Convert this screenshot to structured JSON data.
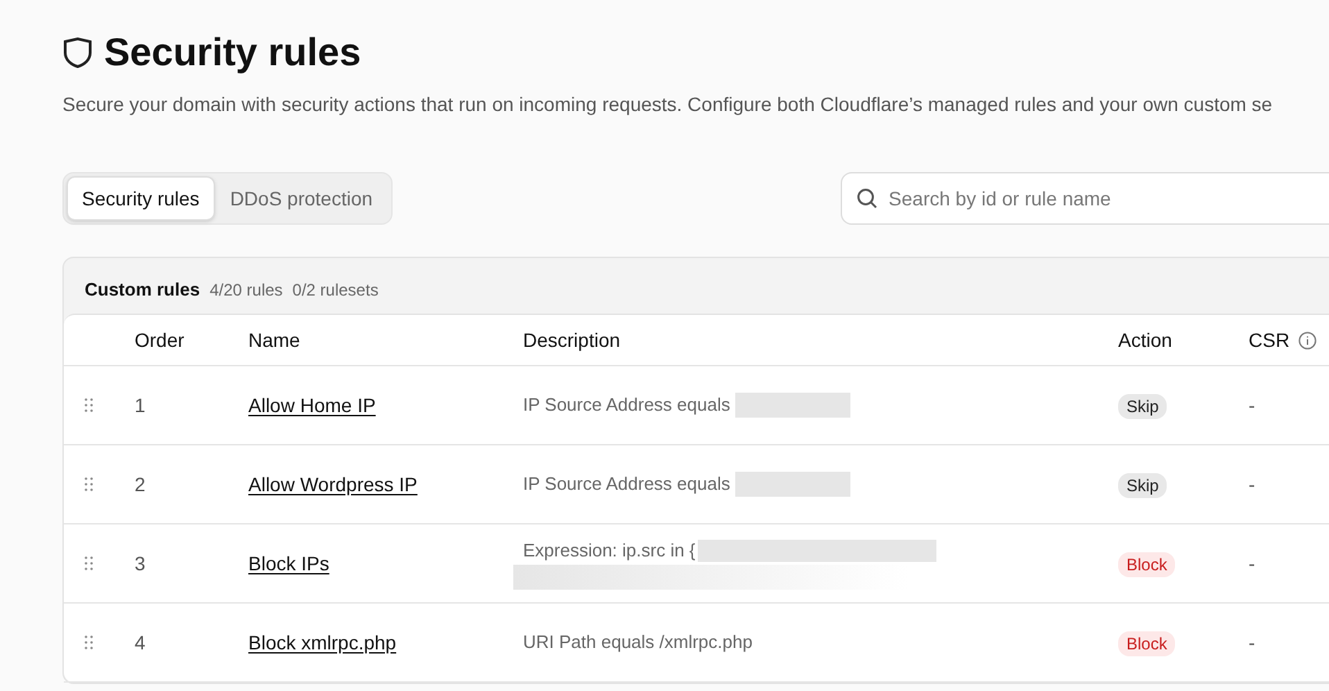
{
  "page": {
    "title": "Security rules",
    "description": "Secure your domain with security actions that run on incoming requests. Configure both Cloudflare’s managed rules and your own custom se"
  },
  "tabs": [
    {
      "label": "Security rules",
      "selected": true
    },
    {
      "label": "DDoS protection",
      "selected": false
    }
  ],
  "search": {
    "placeholder": "Search by id or rule name"
  },
  "section": {
    "title": "Custom rules",
    "rules_count": "4/20 rules",
    "rulesets_count": "0/2 rulesets"
  },
  "table": {
    "columns": [
      "Order",
      "Name",
      "Description",
      "Action",
      "CSR"
    ],
    "rows": [
      {
        "order": "1",
        "name": "Allow Home IP",
        "description": "IP Source Address equals",
        "kind": "masked",
        "action": {
          "label": "Skip",
          "kind": "skip"
        },
        "csr": "-"
      },
      {
        "order": "2",
        "name": "Allow Wordpress IP",
        "description": "IP Source Address equals",
        "kind": "masked",
        "action": {
          "label": "Skip",
          "kind": "skip"
        },
        "csr": "-"
      },
      {
        "order": "3",
        "name": "Block IPs",
        "description": "Expression: ip.src in {",
        "kind": "wrapped",
        "action": {
          "label": "Block",
          "kind": "block"
        },
        "csr": "-"
      },
      {
        "order": "4",
        "name": "Block xmlrpc.php",
        "description": "URI Path equals /xmlrpc.php",
        "kind": "plain",
        "action": {
          "label": "Block",
          "kind": "block"
        },
        "csr": "-"
      }
    ]
  }
}
